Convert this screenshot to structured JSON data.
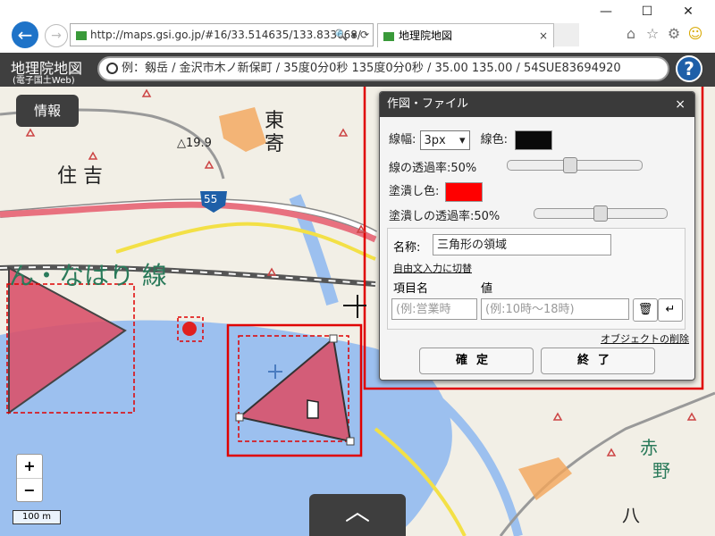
{
  "browser": {
    "url": "http://maps.gsi.go.jp/#16/33.514635/133.833668/",
    "tab_title": "地理院地図",
    "back_glyph": "←",
    "forward_glyph": "→",
    "address_controls": "🔍 ▾ ⟳",
    "tab_close": "×",
    "min_glyph": "—",
    "max_glyph": "☐",
    "close_glyph": "✕",
    "home_glyph": "⌂",
    "fav_glyph": "☆",
    "settings_glyph": "⚙",
    "smile_glyph": "☺"
  },
  "app": {
    "logo_main": "地理院地図",
    "logo_sub": "(電子国土Web)",
    "search_placeholder": "例：剱岳 / 金沢市木ノ新保町 / 35度0分0秒 135度0分0秒 / 35.00 135.00 / 54SUE83694920",
    "help_glyph": "?"
  },
  "map": {
    "info_button": "情報",
    "labels": {
      "higashi_yose_1": "東",
      "higashi_yose_2": "寄",
      "sumiyoshi": "住 吉",
      "elevation": "△19.9",
      "route": "55",
      "coast_text": "ん・なはり 線",
      "aka": "赤",
      "no": "野",
      "hachi": "八"
    },
    "zoom_in": "+",
    "zoom_out": "−",
    "scale": "100 m",
    "bottom_arrow": "︿"
  },
  "dialog": {
    "title": "作図・ファイル",
    "close": "×",
    "line_width_label": "線幅:",
    "line_width_value": "3px",
    "line_color_label": "線色:",
    "line_opacity_label": "線の透過率:50%",
    "line_opacity": 0.5,
    "fill_color_label": "塗潰し色:",
    "fill_opacity_label": "塗潰しの透過率:50%",
    "fill_opacity": 0.5,
    "name_label": "名称:",
    "name_value": "三角形の領域",
    "freeform_link": "自由文入力に切替",
    "item_header": "項目名",
    "value_header": "値",
    "item_placeholder": "(例:営業時",
    "value_placeholder": "(例:10時～18時)",
    "delete_glyph": "🗑",
    "enter_glyph": "↵",
    "delete_object_link": "オブジェクトの削除",
    "confirm_button": "確定",
    "end_button": "終了"
  },
  "colors": {
    "line_color": "#0a0a0a",
    "fill_color": "#ff0000",
    "highlight": "#e00000",
    "polygon_fill": "#d9526a"
  }
}
